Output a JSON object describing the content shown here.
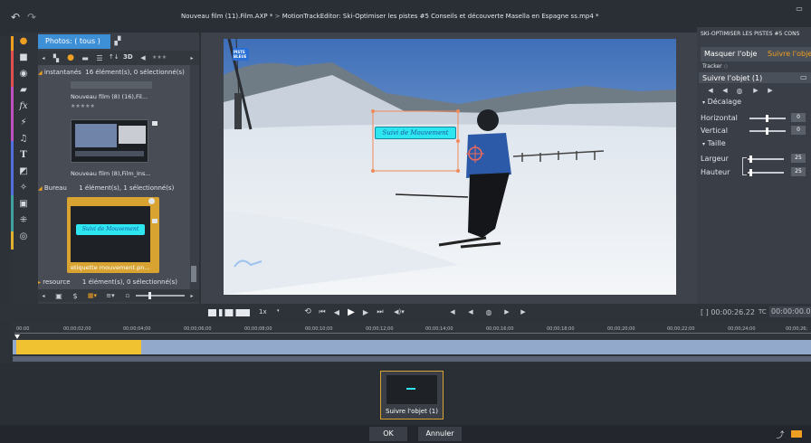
{
  "window": {
    "title_file": "Nouveau film (11).Film.AXP *",
    "title_sep": ">",
    "title_editor": "MotionTrackEditor: Ski-Optimiser les pistes #5  Conseils et découverte Masella en Espagne ss.mp4 *"
  },
  "library": {
    "tab_label": "Photos: ( tous )",
    "groups": [
      {
        "name": "instantanés",
        "count": "16 élément(s), 0 sélectionné(s)"
      },
      {
        "name": "Bureau",
        "count": "1 élément(s), 1 sélectionné(s)"
      },
      {
        "name": "resource",
        "count": "1 élément(s), 0 sélectionné(s)"
      }
    ],
    "items": [
      {
        "label": "Nouveau film (8) (16),Fil...",
        "rating": "★★★★★"
      },
      {
        "label": "Nouveau film (8),Film_Ins..."
      },
      {
        "label": "etiquette mouvement.pn..."
      }
    ],
    "toolbar_sort": "↑↓",
    "toolbar_3d": "3D",
    "thumb_text": "Suivi de Mouvement"
  },
  "preview": {
    "label_text": "Suivi de Mouvement",
    "watermark": "PISTE BLEUE"
  },
  "right_panel": {
    "title": "SKI-OPTIMISER LES PISTES #5  CONS",
    "tab_mask": "Masquer l'obje",
    "tab_follow": "Suivre l'objet",
    "tracker_label": "Tracker",
    "tracker_name": "Suivre l'objet (1)",
    "section_offset": "Décalage",
    "horizontal_label": "Horizontal",
    "horizontal_value": "0",
    "vertical_label": "Vertical",
    "vertical_value": "0",
    "section_size": "Taille",
    "width_label": "Largeur",
    "width_value": "25",
    "height_label": "Hauteur",
    "height_value": "25"
  },
  "transport": {
    "speed": "1x",
    "timecode": "[ ] 00:00:26.22",
    "tc_label": "TC",
    "tc_value": "00:00:00.00"
  },
  "ruler": {
    "ticks": [
      "00:00",
      "00;00;02;00",
      "00;00;04;00",
      "00;00;06;00",
      "00;00;08;00",
      "00;00;10;00",
      "00;00;12;00",
      "00;00;14;00",
      "00;00;16;00",
      "00;00;18;00",
      "00;00;20;00",
      "00;00;22;00",
      "00;00;24;00",
      "00;00;26;"
    ]
  },
  "bottom": {
    "clip_label": "Suivre l'objet (1)",
    "ok": "OK",
    "cancel": "Annuler"
  },
  "colors": {
    "accent": "#3d8fd6",
    "track_fill": "#f0c232",
    "follow_tab": "#f0a020"
  }
}
